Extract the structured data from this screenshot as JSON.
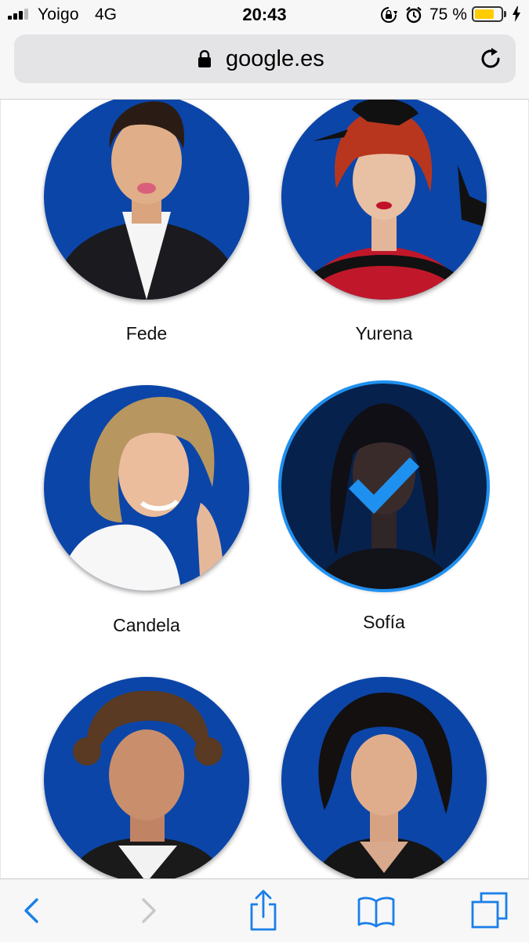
{
  "status_bar": {
    "carrier": "Yoigo",
    "network": "4G",
    "time": "20:43",
    "battery_percent": "75 %",
    "battery_level": 0.75,
    "icons": [
      "signal-bars-icon",
      "rotation-lock-icon",
      "alarm-icon",
      "battery-icon",
      "charging-bolt-icon"
    ]
  },
  "address_bar": {
    "url": "google.es",
    "icons": [
      "padlock-icon",
      "reload-icon"
    ]
  },
  "contestants": [
    {
      "name": "Fede",
      "selected": false
    },
    {
      "name": "Yurena",
      "selected": false
    },
    {
      "name": "Candela",
      "selected": false
    },
    {
      "name": "Sofía",
      "selected": true
    },
    {
      "name": "",
      "selected": false
    },
    {
      "name": "",
      "selected": false
    }
  ],
  "colors": {
    "accent": "#1e90f0",
    "portrait_background": "#0b45a8",
    "toolbar_icon": "#1a7fe8"
  },
  "toolbar": {
    "buttons": [
      {
        "icon": "back-chevron-icon",
        "enabled": true
      },
      {
        "icon": "forward-chevron-icon",
        "enabled": false
      },
      {
        "icon": "share-icon",
        "enabled": true
      },
      {
        "icon": "bookmarks-icon",
        "enabled": true
      },
      {
        "icon": "tabs-icon",
        "enabled": true
      }
    ]
  }
}
